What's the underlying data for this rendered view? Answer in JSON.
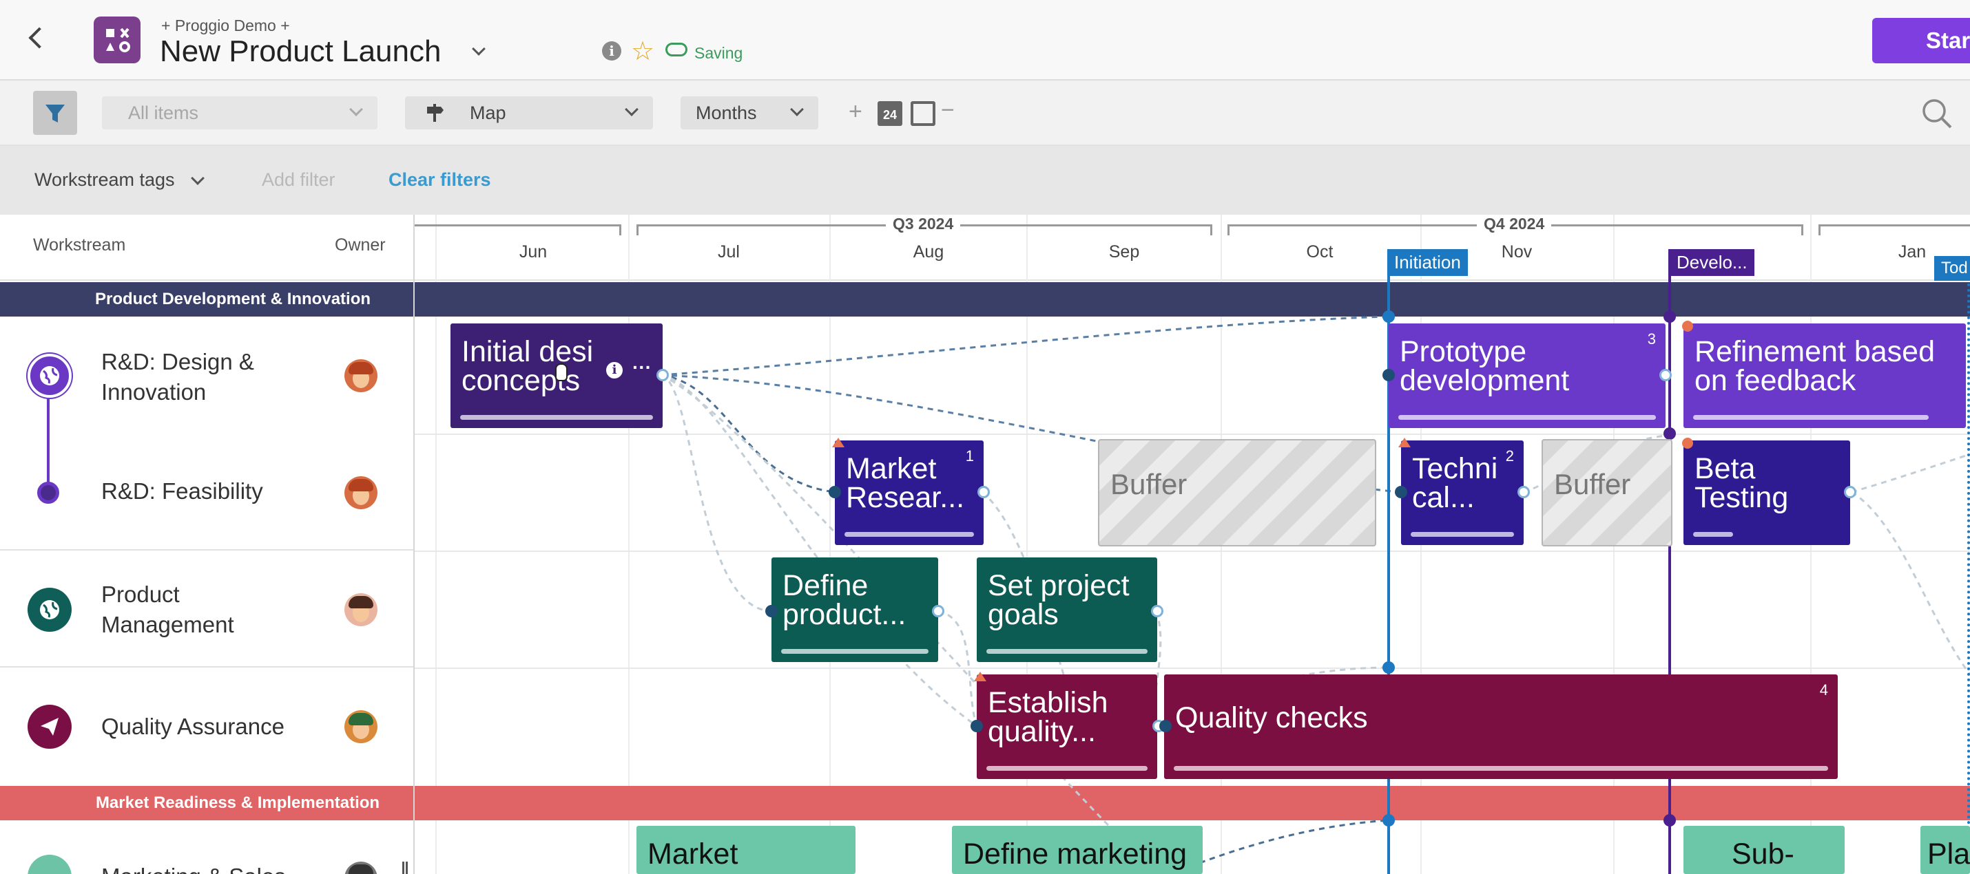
{
  "header": {
    "breadcrumb": "+ Proggio Demo +",
    "title": "New Product Launch",
    "saving_status": "Saving",
    "cta_label": "Start he"
  },
  "toolbar": {
    "items_filter": "All items",
    "view_mode": "Map",
    "time_scale": "Months",
    "zoom_in": "+",
    "zoom_out": "−",
    "calendar_day": "24"
  },
  "filterbar": {
    "tags_label": "Workstream tags",
    "add_filter": "Add filter",
    "clear_filters": "Clear filters"
  },
  "columns": {
    "workstream": "Workstream",
    "owner": "Owner"
  },
  "timeline": {
    "quarters": [
      "Q3 2024",
      "Q4 2024"
    ],
    "months": [
      "Jun",
      "Jul",
      "Aug",
      "Sep",
      "Oct",
      "Nov",
      "Jan"
    ],
    "today_label": "Tod"
  },
  "groups": [
    {
      "label": "Product Development & Innovation",
      "color": "#3a3f68"
    },
    {
      "label": "Market Readiness & Implementation",
      "color": "#e06466"
    }
  ],
  "workstreams": [
    {
      "name": "R&D: Design &\nInnovation",
      "icon": "globe-icon",
      "color": "#6a38c4"
    },
    {
      "name": "R&D: Feasibility",
      "icon": "dot-icon",
      "color": "#4b2a8e"
    },
    {
      "name": "Product\nManagement",
      "icon": "globe-icon",
      "color": "#0f5e57"
    },
    {
      "name": "Quality Assurance",
      "icon": "paper-plane-icon",
      "color": "#7a0f45"
    },
    {
      "name": "Marketing & Sales",
      "icon": "chart-icon",
      "color": "#6cc3a6"
    }
  ],
  "milestones": [
    {
      "label": "Initiation",
      "color": "#1c78c0"
    },
    {
      "label": "Develo...",
      "color": "#4a1f8e"
    }
  ],
  "tasks": [
    {
      "label": "Initial desi\nconcepts",
      "color": "#3d1f73",
      "num": ""
    },
    {
      "label": "Prototype\ndevelopment",
      "color": "#6a39c9",
      "num": "3"
    },
    {
      "label": "Refinement based\non feedback",
      "color": "#6a39c9",
      "num": ""
    },
    {
      "label": "Market\nResear...",
      "color": "#2e1a91",
      "num": "1"
    },
    {
      "label": "Techni\ncal...",
      "color": "#2e1a91",
      "num": "2"
    },
    {
      "label": "Beta\nTesting",
      "color": "#2e1a91",
      "num": ""
    },
    {
      "label": "Define\nproduct...",
      "color": "#0d5c54",
      "num": ""
    },
    {
      "label": "Set project\ngoals",
      "color": "#0d5c54",
      "num": ""
    },
    {
      "label": "Establish\nquality...",
      "color": "#7b0f42",
      "num": ""
    },
    {
      "label": "Quality checks",
      "color": "#7b0f42",
      "num": "4"
    },
    {
      "label": "Market",
      "color": "#6cc7a8",
      "num": ""
    },
    {
      "label": "Define marketing",
      "color": "#6cc7a8",
      "num": ""
    },
    {
      "label": "Sub-",
      "color": "#6cc7a8",
      "num": ""
    },
    {
      "label": "Pla",
      "color": "#6cc7a8",
      "num": ""
    }
  ],
  "buffers": [
    "Buffer",
    "Buffer"
  ]
}
